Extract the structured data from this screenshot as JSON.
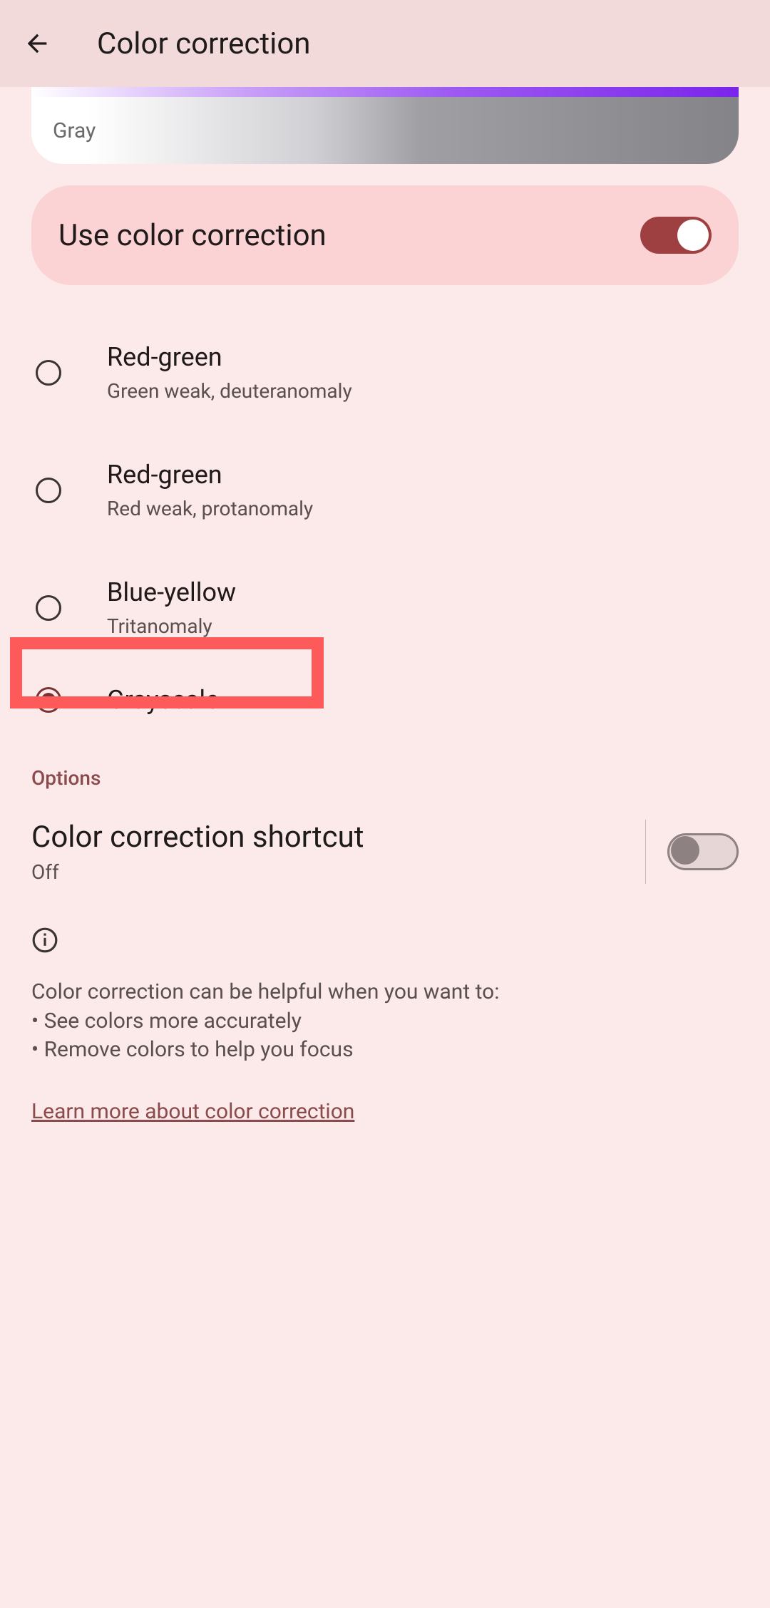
{
  "header": {
    "title": "Color correction"
  },
  "preview": {
    "label": "Gray"
  },
  "toggle": {
    "label": "Use color correction",
    "on": true
  },
  "modes": [
    {
      "title": "Red-green",
      "sub": "Green weak, deuteranomaly",
      "selected": false
    },
    {
      "title": "Red-green",
      "sub": "Red weak, protanomaly",
      "selected": false
    },
    {
      "title": "Blue-yellow",
      "sub": "Tritanomaly",
      "selected": false
    },
    {
      "title": "Grayscale",
      "sub": "",
      "selected": true
    }
  ],
  "options": {
    "header": "Options",
    "shortcut": {
      "title": "Color correction shortcut",
      "sub": "Off",
      "on": false
    }
  },
  "info": {
    "line1": "Color correction can be helpful when you want to:",
    "line2": "• See colors more accurately",
    "line3": "• Remove colors to help you focus"
  },
  "learn_more": "Learn more about color correction"
}
